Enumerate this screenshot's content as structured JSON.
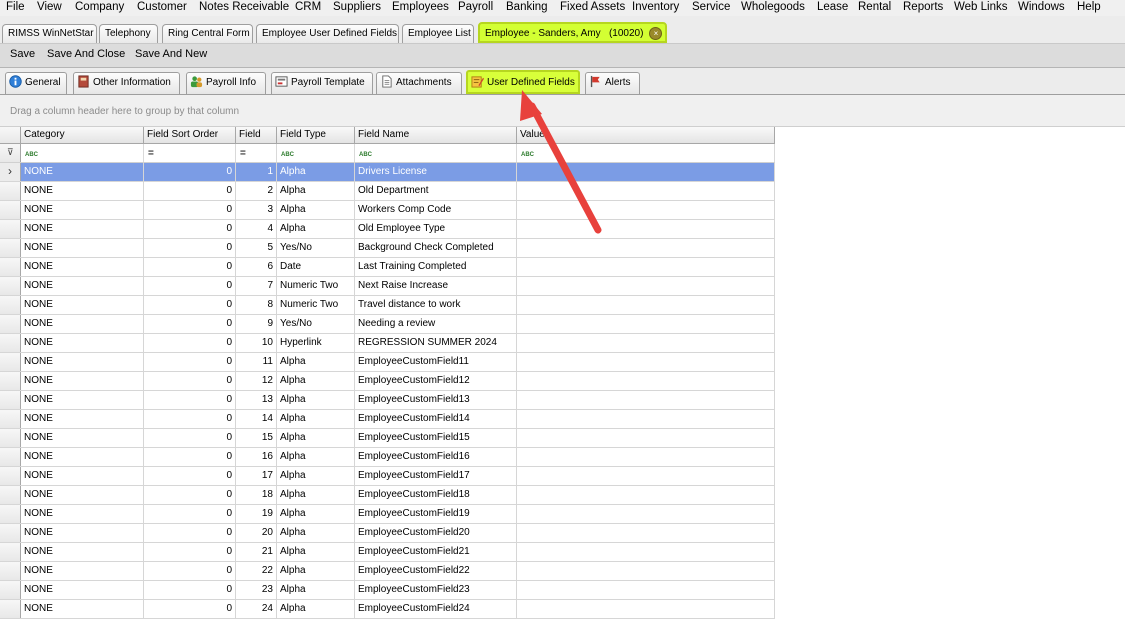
{
  "menu": [
    "File",
    "View",
    "Company",
    "Customer",
    "Notes Receivable",
    "CRM",
    "Suppliers",
    "Employees",
    "Payroll",
    "Banking",
    "Fixed Assets",
    "Inventory",
    "Service",
    "Wholegoods",
    "Lease",
    "Rental",
    "Reports",
    "Web Links",
    "Windows",
    "Help"
  ],
  "doc_tabs": [
    {
      "label": "RIMSS WinNetStar"
    },
    {
      "label": "Telephony"
    },
    {
      "label": "Ring Central Form"
    },
    {
      "label": "Employee User Defined Fields"
    },
    {
      "label": "Employee List"
    },
    {
      "label": "Employee - Sanders, Amy   (10020)",
      "active": true,
      "close_glyph": "×"
    }
  ],
  "toolbar": {
    "save": "Save",
    "save_close": "Save And Close",
    "save_new": "Save And New"
  },
  "sub_tabs": [
    {
      "label": "General",
      "icon": "info-icon"
    },
    {
      "label": "Other Information",
      "icon": "book-icon"
    },
    {
      "label": "Payroll Info",
      "icon": "people-icon"
    },
    {
      "label": "Payroll Template",
      "icon": "template-icon"
    },
    {
      "label": "Attachments",
      "icon": "document-icon"
    },
    {
      "label": "User Defined Fields",
      "icon": "edit-note-icon",
      "active": true
    },
    {
      "label": "Alerts",
      "icon": "flag-icon"
    }
  ],
  "group_panel_hint": "Drag a column header here to group by that column",
  "columns": [
    "Category",
    "Field Sort Order",
    "Field",
    "Field Type",
    "Field Name",
    "Value"
  ],
  "filter_row": {
    "text_glyph": "ABC",
    "numeric_glyph": "="
  },
  "rows": [
    [
      "NONE",
      "0",
      "1",
      "Alpha",
      "Drivers License",
      ""
    ],
    [
      "NONE",
      "0",
      "2",
      "Alpha",
      "Old Department",
      ""
    ],
    [
      "NONE",
      "0",
      "3",
      "Alpha",
      "Workers Comp Code",
      ""
    ],
    [
      "NONE",
      "0",
      "4",
      "Alpha",
      "Old Employee Type",
      ""
    ],
    [
      "NONE",
      "0",
      "5",
      "Yes/No",
      "Background Check Completed",
      ""
    ],
    [
      "NONE",
      "0",
      "6",
      "Date",
      "Last Training Completed",
      ""
    ],
    [
      "NONE",
      "0",
      "7",
      "Numeric Two",
      "Next Raise Increase",
      ""
    ],
    [
      "NONE",
      "0",
      "8",
      "Numeric Two",
      "Travel distance to work",
      ""
    ],
    [
      "NONE",
      "0",
      "9",
      "Yes/No",
      "Needing a review",
      ""
    ],
    [
      "NONE",
      "0",
      "10",
      "Hyperlink",
      "REGRESSION SUMMER 2024",
      ""
    ],
    [
      "NONE",
      "0",
      "11",
      "Alpha",
      "EmployeeCustomField11",
      ""
    ],
    [
      "NONE",
      "0",
      "12",
      "Alpha",
      "EmployeeCustomField12",
      ""
    ],
    [
      "NONE",
      "0",
      "13",
      "Alpha",
      "EmployeeCustomField13",
      ""
    ],
    [
      "NONE",
      "0",
      "14",
      "Alpha",
      "EmployeeCustomField14",
      ""
    ],
    [
      "NONE",
      "0",
      "15",
      "Alpha",
      "EmployeeCustomField15",
      ""
    ],
    [
      "NONE",
      "0",
      "16",
      "Alpha",
      "EmployeeCustomField16",
      ""
    ],
    [
      "NONE",
      "0",
      "17",
      "Alpha",
      "EmployeeCustomField17",
      ""
    ],
    [
      "NONE",
      "0",
      "18",
      "Alpha",
      "EmployeeCustomField18",
      ""
    ],
    [
      "NONE",
      "0",
      "19",
      "Alpha",
      "EmployeeCustomField19",
      ""
    ],
    [
      "NONE",
      "0",
      "20",
      "Alpha",
      "EmployeeCustomField20",
      ""
    ],
    [
      "NONE",
      "0",
      "21",
      "Alpha",
      "EmployeeCustomField21",
      ""
    ],
    [
      "NONE",
      "0",
      "22",
      "Alpha",
      "EmployeeCustomField22",
      ""
    ],
    [
      "NONE",
      "0",
      "23",
      "Alpha",
      "EmployeeCustomField23",
      ""
    ],
    [
      "NONE",
      "0",
      "24",
      "Alpha",
      "EmployeeCustomField24",
      ""
    ]
  ],
  "selected_row": 0,
  "colors": {
    "highlight": "#d3ff33",
    "selection": "#7b9ce5",
    "arrow": "#e8413c"
  }
}
